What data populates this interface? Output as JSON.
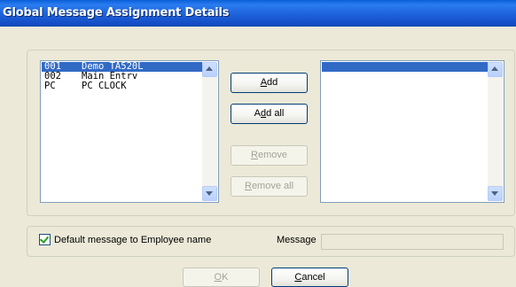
{
  "window": {
    "title": "Global Message Assignment Details"
  },
  "available_list": {
    "items": [
      {
        "code": "001",
        "name": "Demo TA520L",
        "selected": true
      },
      {
        "code": "002",
        "name": "Main Entrv",
        "selected": false
      },
      {
        "code": "PC",
        "name": "PC CLOCK",
        "selected": false
      }
    ]
  },
  "assigned_list": {
    "items": []
  },
  "buttons": {
    "add": {
      "pre": "",
      "key": "A",
      "post": "dd",
      "enabled": true
    },
    "add_all": {
      "pre": "A",
      "key": "d",
      "post": "d all",
      "enabled": true
    },
    "remove": {
      "pre": "",
      "key": "R",
      "post": "emove",
      "enabled": false
    },
    "remove_all": {
      "pre": "",
      "key": "R",
      "post": "emove all",
      "enabled": false
    },
    "ok": {
      "pre": "",
      "key": "O",
      "post": "K",
      "enabled": false
    },
    "cancel": {
      "pre": "",
      "key": "C",
      "post": "ancel",
      "enabled": true
    }
  },
  "options": {
    "default_to_employee_label": "Default message to Employee name",
    "default_to_employee_checked": true,
    "message_label": "Message",
    "message_value": ""
  },
  "colors": {
    "selection": "#316ac5",
    "title_bar": "#1f64dc",
    "dialog_bg": "#ece9d8"
  }
}
